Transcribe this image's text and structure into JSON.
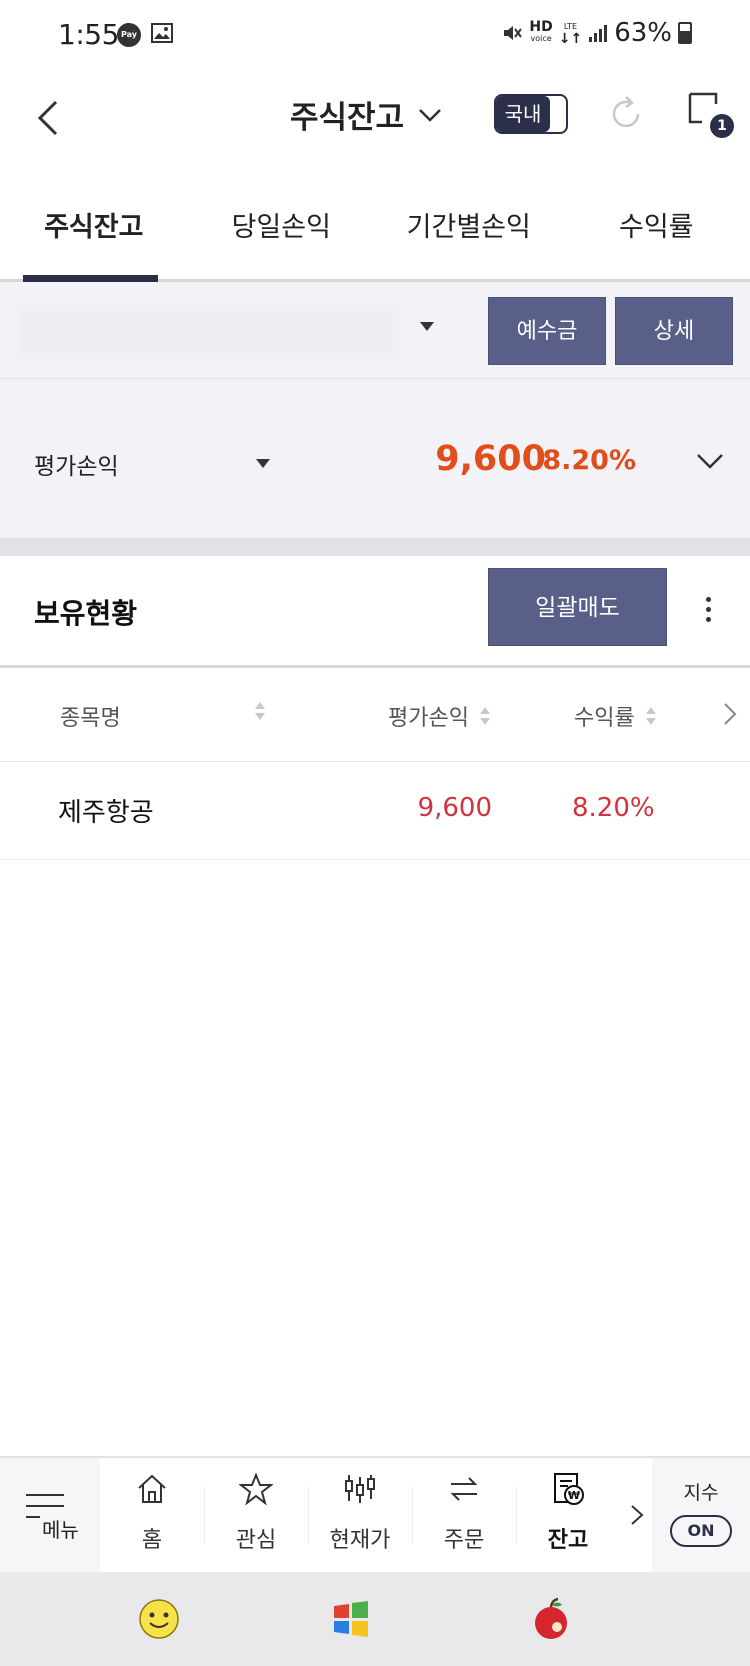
{
  "status_bar": {
    "time": "1:55",
    "pay_label": "Pay",
    "hd_label": "HD",
    "voice_label": "voice",
    "lte_label": "LTE",
    "battery": "63%"
  },
  "header": {
    "title": "주식잔고",
    "market_toggle": "국내",
    "window_count": "1"
  },
  "tabs": [
    {
      "label": "주식잔고",
      "active": true
    },
    {
      "label": "당일손익",
      "active": false
    },
    {
      "label": "기간별손익",
      "active": false
    },
    {
      "label": "수익률",
      "active": false
    }
  ],
  "account": {
    "deposit_button": "예수금",
    "detail_button": "상세"
  },
  "summary": {
    "label": "평가손익",
    "value": "9,600",
    "rate": "8.20%"
  },
  "holdings": {
    "title": "보유현황",
    "sell_all_button": "일괄매도",
    "columns": {
      "name": "종목명",
      "pl": "평가손익",
      "rate": "수익률"
    },
    "rows": [
      {
        "name": "제주항공",
        "pl": "9,600",
        "rate": "8.20%"
      }
    ]
  },
  "bottom_nav": {
    "menu_label": "메뉴",
    "items": [
      {
        "label": "홈",
        "icon": "home-icon"
      },
      {
        "label": "관심",
        "icon": "star-icon"
      },
      {
        "label": "현재가",
        "icon": "candlestick-icon"
      },
      {
        "label": "주문",
        "icon": "swap-icon"
      },
      {
        "label": "잔고",
        "icon": "balance-icon",
        "active": true
      }
    ],
    "index_label": "지수",
    "index_toggle": "ON"
  },
  "colors": {
    "navy": "#2b2f4a",
    "button": "#5a5f8a",
    "profit_orange": "#e04e1b",
    "profit_red": "#d0343f"
  }
}
